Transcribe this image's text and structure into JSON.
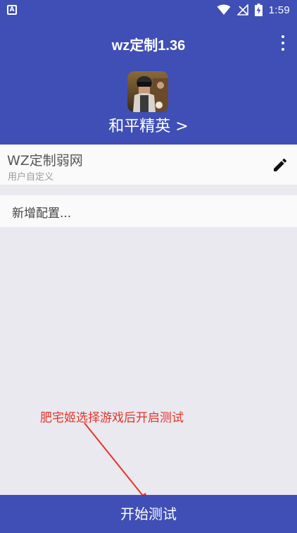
{
  "statusbar": {
    "notification_icon": "app-notification-icon",
    "time": "1:59",
    "icons": [
      "wifi-icon",
      "no-signal-icon",
      "battery-charging-icon"
    ]
  },
  "header": {
    "title": "wz定制1.36",
    "menu_icon": "more-vert-icon",
    "game_name": "和平精英 >"
  },
  "config": {
    "name": "WZ定制弱网",
    "subtitle": "用户自定义",
    "edit_icon": "pencil-icon"
  },
  "add_config": {
    "label": "新增配置..."
  },
  "annotation": {
    "text": "肥宅姬选择游戏后开启测试"
  },
  "bottom_button": {
    "label": "开始测试"
  },
  "colors": {
    "primary": "#3f4fb5",
    "background": "#e9e9ef",
    "annotation": "#e6332a"
  }
}
